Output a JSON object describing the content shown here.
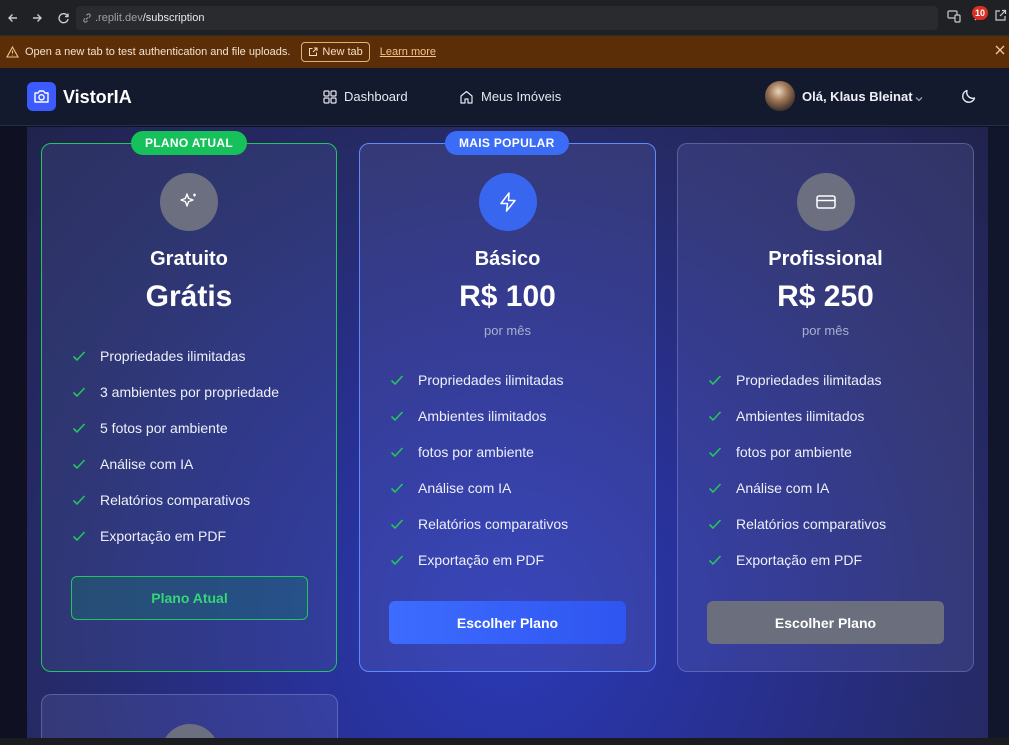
{
  "browser": {
    "url_domain": ".replit.dev",
    "url_path": "/subscription",
    "notification_count": "10"
  },
  "banner": {
    "message": "Open a new tab to test authentication and file uploads.",
    "new_tab_label": "New tab",
    "learn_more_label": "Learn more"
  },
  "header": {
    "app_name": "VistorIA",
    "nav": [
      {
        "label": "Dashboard",
        "icon": "grid-icon"
      },
      {
        "label": "Meus Imóveis",
        "icon": "home-icon"
      }
    ],
    "user_greeting": "Olá, Klaus Bleinat"
  },
  "plans": [
    {
      "badge": "PLANO ATUAL",
      "name": "Gratuito",
      "price": "Grátis",
      "period": "",
      "icon": "sparkles-icon",
      "features": [
        "Propriedades ilimitadas",
        "3 ambientes por propriedade",
        "5 fotos por ambiente",
        "Análise com IA",
        "Relatórios comparativos",
        "Exportação em PDF"
      ],
      "button": "Plano Atual"
    },
    {
      "badge": "MAIS POPULAR",
      "name": "Básico",
      "price": "R$ 100",
      "period": "por mês",
      "icon": "zap-icon",
      "features": [
        "Propriedades ilimitadas",
        "Ambientes ilimitados",
        "fotos por ambiente",
        "Análise com IA",
        "Relatórios comparativos",
        "Exportação em PDF"
      ],
      "button": "Escolher Plano"
    },
    {
      "badge": "",
      "name": "Profissional",
      "price": "R$ 250",
      "period": "por mês",
      "icon": "credit-card-icon",
      "features": [
        "Propriedades ilimitadas",
        "Ambientes ilimitados",
        "fotos por ambiente",
        "Análise com IA",
        "Relatórios comparativos",
        "Exportação em PDF"
      ],
      "button": "Escolher Plano"
    }
  ],
  "colors": {
    "accent_blue": "#3b6cf6",
    "current_green": "#16c05a",
    "check_green": "#22c55e"
  }
}
